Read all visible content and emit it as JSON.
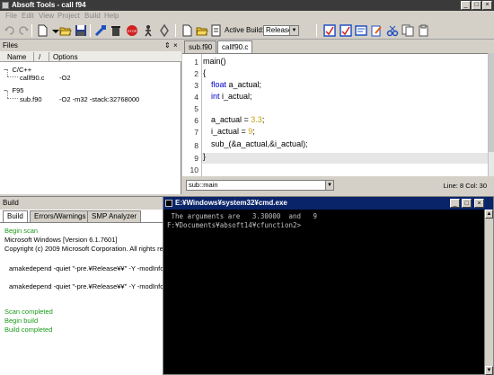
{
  "window": {
    "title": "Absoft Tools - call f94",
    "min": "_",
    "max": "□",
    "close": "×"
  },
  "menu": [
    "File",
    "Edit",
    "View",
    "Project",
    "Build",
    "Help"
  ],
  "toolbar": {
    "active_build_label": "Active Build:",
    "active_build_value": "Release"
  },
  "files": {
    "title": "Files",
    "pin": "⇕",
    "close": "×",
    "col_name": "Name",
    "col_options": "Options",
    "tree": [
      {
        "name": "C/C++",
        "options": "",
        "expander": "−"
      },
      {
        "name": "callf90.c",
        "options": "-O2",
        "expander": ""
      },
      {
        "name": "F95",
        "options": "",
        "expander": "−"
      },
      {
        "name": "sub.f90",
        "options": "-O2 -m32 -stack:32768000",
        "expander": ""
      }
    ]
  },
  "editor": {
    "tabs": [
      "sub.f90",
      "callf90.c"
    ],
    "line_numbers": [
      "1",
      "2",
      "3",
      "4",
      "5",
      "6",
      "7",
      "8",
      "9",
      "10"
    ],
    "lines": {
      "l1": "main()",
      "l2": "{",
      "l3_kw": "float",
      "l3_rest": " a_actual;",
      "l4_kw": "int",
      "l4_rest": " i_actual;",
      "l6_a": "a_actual = ",
      "l6_num": "3.3",
      "l6_b": ";",
      "l7_a": "i_actual = ",
      "l7_num": "9",
      "l7_b": ";",
      "l8": "sub_(&a_actual,&i_actual);",
      "l9": "}"
    },
    "function_select": "sub::main",
    "status": "Line: 8 Col: 30"
  },
  "build": {
    "title": "Build",
    "tabs": [
      "Build",
      "Errors/Warnings",
      "SMP Analyzer"
    ],
    "lines": [
      {
        "text": "Begin scan",
        "color": "#1a9a1a"
      },
      {
        "text": "Microsoft Windows [Version 6.1.7601]",
        "color": "#000000"
      },
      {
        "text": "Copyright (c) 2009 Microsoft Corporation.  All rights re",
        "color": "#000000"
      },
      {
        "text": "amakedepend -quiet \"-pre.¥Release¥¥\" -Y -modInfo -",
        "color": "#000000"
      },
      {
        "text": "amakedepend -quiet \"-pre.¥Release¥¥\" -Y -modInfo -",
        "color": "#000000"
      },
      {
        "text": "Scan completed",
        "color": "#1a9a1a"
      },
      {
        "text": "Begin build",
        "color": "#1a9a1a"
      },
      {
        "text": "Build completed",
        "color": "#1a9a1a"
      }
    ]
  },
  "cmd": {
    "title": "E:¥Windows¥system32¥cmd.exe",
    "line1": " The arguments are   3.30000  and   9",
    "line2": "F:¥Documents¥absoft14¥cfunction2>",
    "min": "_",
    "max": "□",
    "close": "×",
    "up": "▲",
    "down": "▼"
  },
  "colors": {
    "keyword": "#0000c8",
    "number": "#c8a000",
    "build_green": "#1a9a1a",
    "cmd_title": "#0a246a"
  }
}
